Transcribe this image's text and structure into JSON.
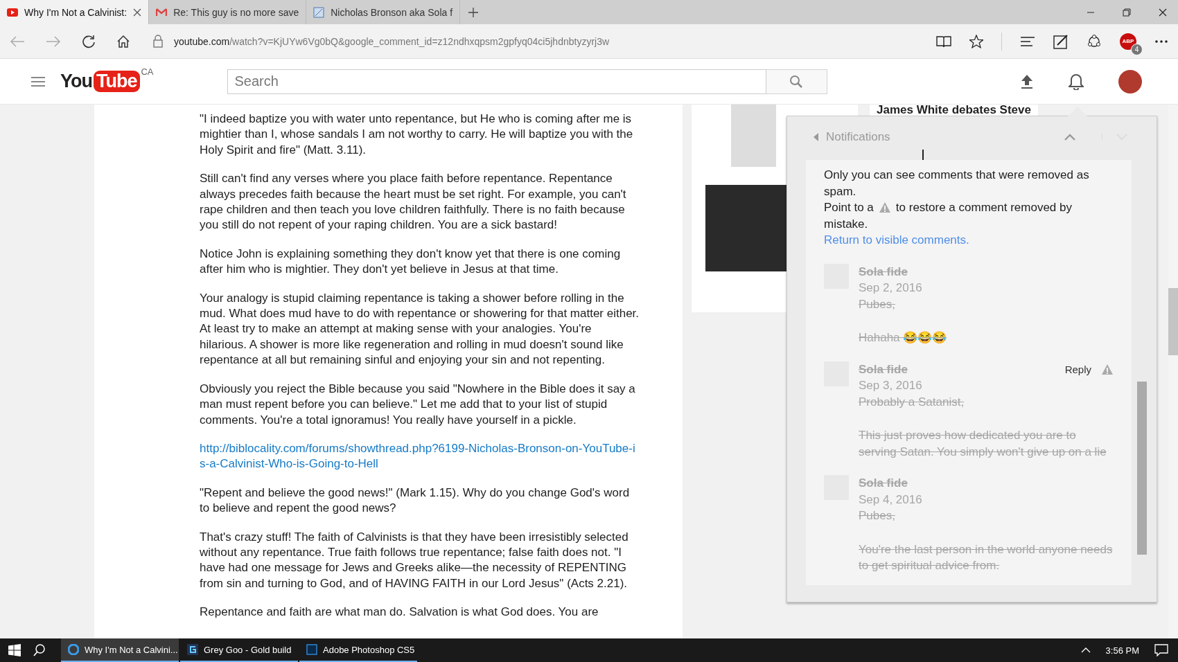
{
  "browser": {
    "tabs": [
      {
        "title": "Why I'm Not a Calvinist:",
        "kind": "youtube",
        "selected": true
      },
      {
        "title": "Re: This guy is no more save",
        "kind": "mail",
        "selected": false
      },
      {
        "title": "Nicholas Bronson aka Sola f",
        "kind": "page",
        "selected": false
      }
    ],
    "address": {
      "domain": "youtube.com",
      "path": "/watch?v=KjUYw6Vg0bQ&google_comment_id=z12ndhxqpsm2gpfyq04ci5jhdnbtyzyrj3w"
    },
    "extension_badge": {
      "label": "ABP",
      "count": "4"
    }
  },
  "header": {
    "logo": {
      "part1": "You",
      "part2": "Tube",
      "region": "CA"
    },
    "search": {
      "placeholder": "Search"
    }
  },
  "comment": {
    "paragraphs": [
      {
        "kind": "text",
        "text": "\"I indeed baptize you with water unto repentance, but He who is coming after me is mightier than I, whose sandals I am not worthy to carry. He will baptize you with the Holy Spirit and fire\" (Matt. 3.11)."
      },
      {
        "kind": "text",
        "text": "Still can't find any verses where you place faith before repentance. Repentance always precedes faith because the heart must be set right. For example, you can't rape children and then teach you love children faithfully. There is no faith because you still do not repent of your raping children. You are a sick bastard!"
      },
      {
        "kind": "text",
        "text": "Notice John is explaining something they don't know yet that there is one coming after him who is mightier. They don't yet believe in Jesus at that time."
      },
      {
        "kind": "text",
        "text": "Your analogy is stupid claiming repentance is taking a shower before rolling in the mud. What does mud have to do with repentance or showering for that matter either. At least try to make an attempt at making sense with your analogies. You're hilarious. A shower is more like regeneration and rolling in mud doesn't sound like repentance at all but remaining sinful and enjoying your sin and not repenting."
      },
      {
        "kind": "text",
        "text": "Obviously you reject the Bible because you said \"Nowhere in the Bible does it say a man must repent before you can believe.\" Let me add that to your list of stupid comments. You're a total ignoramus! You really have yourself in a pickle."
      },
      {
        "kind": "link",
        "text": "http://biblocality.com/forums/showthread.php?6199-Nicholas-Bronson-on-YouTube-is-a-Calvinist-Who-is-Going-to-Hell"
      },
      {
        "kind": "text",
        "text": "\"Repent and believe the good news!\" (Mark 1.15). Why do you change God's word to believe and repent the good news?"
      },
      {
        "kind": "text",
        "text": "That's crazy stuff! The faith of Calvinists is that they have been irresistibly selected without any repentance. True faith follows true repentance; false faith does not. \"I have had one message for Jews and Greeks alike—the necessity of REPENTING from sin and turning to God, and of HAVING FAITH in our Lord Jesus\" (Acts 2.21)."
      },
      {
        "kind": "text",
        "text": "Repentance and faith are what man do. Salvation is what God does. You are"
      }
    ]
  },
  "sidebar": {
    "video_title": "James White debates Steve"
  },
  "notifications": {
    "title": "Notifications",
    "info": [
      "Only you can see comments that were removed as spam."
    ],
    "info_suffix": [
      "to restore a comment removed by",
      "mistake."
    ],
    "info_prefix": "Point to a",
    "return_link": "Return to visible comments.",
    "comments": [
      {
        "author": "Sola fide",
        "date": "Sep 2, 2016",
        "lines": [
          "Pubes,",
          "Hahaha 😂😂😂"
        ],
        "removed": true
      },
      {
        "author": "Sola fide",
        "date": "Sep 3, 2016",
        "lines": [
          "Probably a Satanist,",
          "This just proves how dedicated you are to serving Satan. You simply won't give up on a lie"
        ],
        "removed": true,
        "reply": "Reply"
      },
      {
        "author": "Sola fide",
        "date": "Sep 4, 2016",
        "lines": [
          "Pubes,",
          "You're the last person in the world anyone needs to get spiritual advice from."
        ],
        "removed": true
      }
    ]
  },
  "taskbar": {
    "apps": [
      {
        "title": "Why I'm Not a Calvini...",
        "kind": "edge",
        "selected": true
      },
      {
        "title": "Grey Goo - Gold build",
        "kind": "g",
        "selected": false
      },
      {
        "title": "Adobe Photoshop CS5",
        "kind": "ps",
        "selected": false
      }
    ],
    "time": "3:56 PM"
  }
}
